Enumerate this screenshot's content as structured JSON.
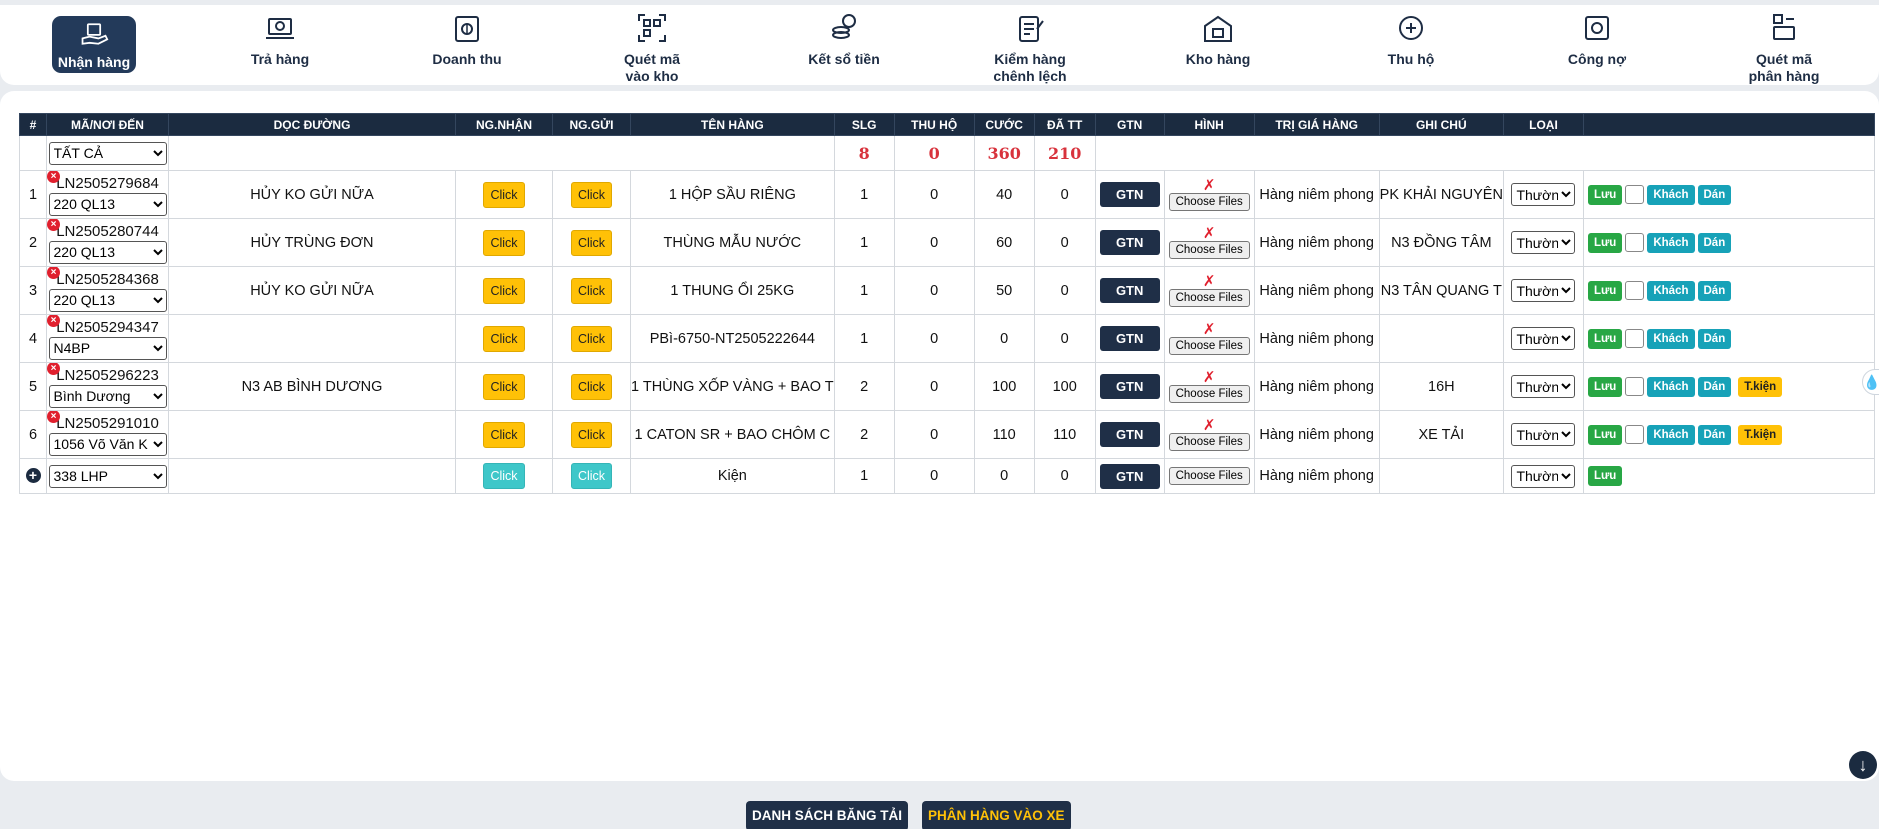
{
  "nav": [
    {
      "label": "Nhận hàng",
      "icon": "hand-package-icon",
      "active": true
    },
    {
      "label": "Trả hàng",
      "icon": "laptop-return-icon"
    },
    {
      "label": "Doanh thu",
      "icon": "cash-revenue-icon"
    },
    {
      "label": "Quét mã\nvào kho",
      "icon": "qr-scan-icon"
    },
    {
      "label": "Kết sổ tiền",
      "icon": "coins-icon"
    },
    {
      "label": "Kiểm hàng\nchênh lệch",
      "icon": "clipboard-check-icon"
    },
    {
      "label": "Kho hàng",
      "icon": "warehouse-icon"
    },
    {
      "label": "Thu hộ",
      "icon": "collect-money-icon"
    },
    {
      "label": "Công nợ",
      "icon": "safe-icon"
    },
    {
      "label": "Quét mã\nphân hàng",
      "icon": "scan-sort-icon"
    }
  ],
  "table": {
    "headers": [
      "#",
      "MÃ/NƠI ĐẾN",
      "DỌC ĐƯỜNG",
      "NG.NHẬN",
      "NG.GỬI",
      "TÊN HÀNG",
      "SLG",
      "THU HỘ",
      "CƯỚC",
      "ĐÃ TT",
      "GTN",
      "HÌNH",
      "TRỊ GIÁ HÀNG",
      "GHI CHÚ",
      "LOẠI",
      ""
    ],
    "filter_select": "TẤT CẢ",
    "totals": {
      "slg": "8",
      "thu_ho": "0",
      "cuoc": "360",
      "da_tt": "210"
    },
    "click_label": "Click",
    "gtn_label": "GTN",
    "choose_files_label": "Choose Files",
    "image_missing_mark": "✗",
    "save_label": "Lưu",
    "customer_label": "Khách",
    "paste_label": "Dán",
    "parcel_label": "T.kiện",
    "rows": [
      {
        "idx": "1",
        "code": "LN2505279684",
        "dest": "220 QL13",
        "route": "HỦY KO GỬI NỮA",
        "name": "1 HỘP SẦU RIÊNG",
        "slg": "1",
        "thu_ho": "0",
        "cuoc": "40",
        "da_tt": "0",
        "value": "Hàng niêm phong",
        "note": "PK KHẢI NGUYÊN",
        "type": "Thường",
        "parcel": false
      },
      {
        "idx": "2",
        "code": "LN2505280744",
        "dest": "220 QL13",
        "route": "HỦY TRÙNG ĐƠN",
        "name": "THÙNG MẪU NƯỚC",
        "slg": "1",
        "thu_ho": "0",
        "cuoc": "60",
        "da_tt": "0",
        "value": "Hàng niêm phong",
        "note": "N3 ĐỒNG TÂM",
        "type": "Thường",
        "parcel": false
      },
      {
        "idx": "3",
        "code": "LN2505284368",
        "dest": "220 QL13",
        "route": "HỦY KO GỬI NỮA",
        "name": "1 THUNG ỔI 25KG",
        "slg": "1",
        "thu_ho": "0",
        "cuoc": "50",
        "da_tt": "0",
        "value": "Hàng niêm phong",
        "note": "N3 TÂN QUANG T",
        "type": "Thường",
        "parcel": false
      },
      {
        "idx": "4",
        "code": "LN2505294347",
        "dest": "N4BP",
        "route": "",
        "name": "PBì-6750-NT2505222644",
        "slg": "1",
        "thu_ho": "0",
        "cuoc": "0",
        "da_tt": "0",
        "value": "Hàng niêm phong",
        "note": "",
        "type": "Thường",
        "parcel": false
      },
      {
        "idx": "5",
        "code": "LN2505296223",
        "dest": "Bình Dương",
        "route": "N3 AB BÌNH DƯƠNG",
        "name": "1 THÙNG XỐP VÀNG + BAO T",
        "slg": "2",
        "thu_ho": "0",
        "cuoc": "100",
        "da_tt": "100",
        "value": "Hàng niêm phong",
        "note": "16H",
        "type": "Thường",
        "parcel": true
      },
      {
        "idx": "6",
        "code": "LN2505291010",
        "dest": "1056 Võ Văn K",
        "route": "",
        "name": "1 CATON SR + BAO CHÔM C",
        "slg": "2",
        "thu_ho": "0",
        "cuoc": "110",
        "da_tt": "110",
        "value": "Hàng niêm phong",
        "note": "XE TẢI",
        "type": "Thường",
        "parcel": true
      }
    ],
    "add_row": {
      "dest": "338 LHP",
      "name": "Kiện",
      "slg": "1",
      "thu_ho": "0",
      "cuoc": "0",
      "da_tt": "0",
      "value": "Hàng niêm phong",
      "type": "Thường"
    }
  },
  "bottom": {
    "list_button": "DANH SÁCH BĂNG TẢI",
    "sort_button": "PHÂN HÀNG VÀO XE"
  },
  "colors": {
    "navy": "#1b2b40",
    "accent_yellow": "#ffc107",
    "danger": "#d8323c",
    "success": "#28a745",
    "info": "#17a2b8"
  }
}
